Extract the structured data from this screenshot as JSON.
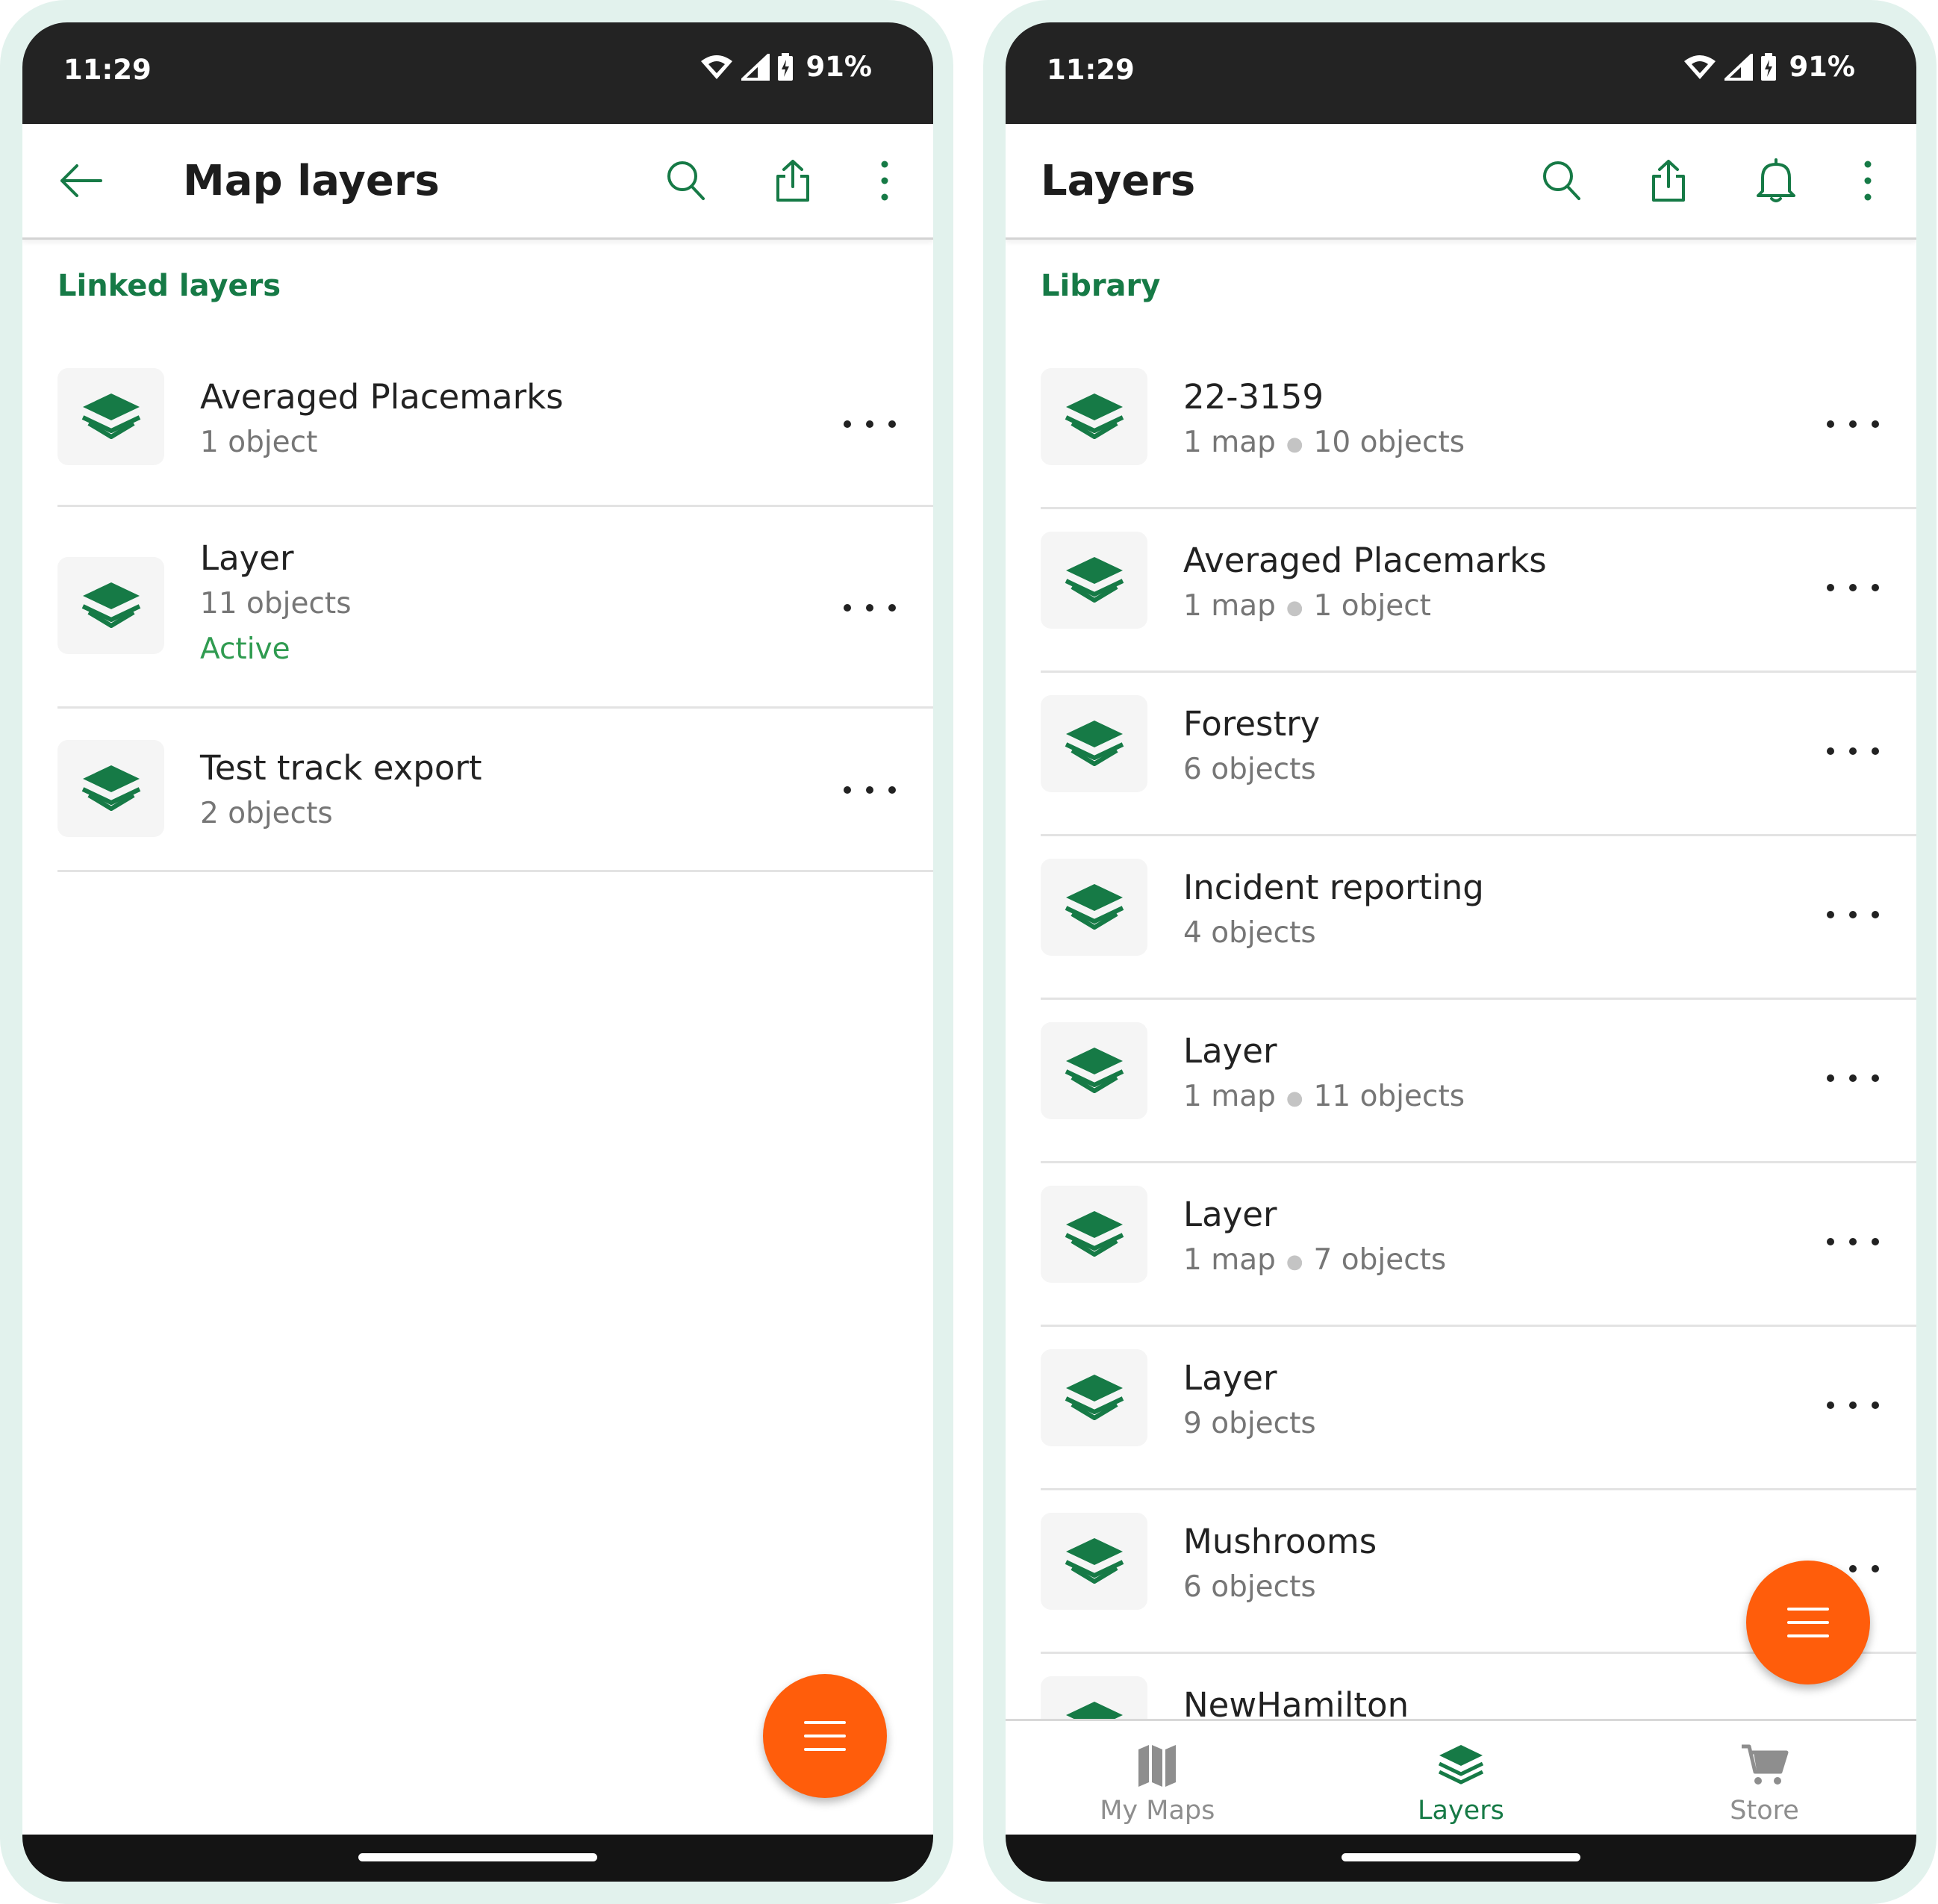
{
  "colors": {
    "accent": "#167a46",
    "fab": "#ff5d0b",
    "active": "#2f9b50",
    "statusbar": "#232323",
    "frame": "#e2f2ed"
  },
  "left": {
    "status": {
      "time": "11:29",
      "battery": "91%"
    },
    "appbar": {
      "title": "Map layers"
    },
    "section_header": "Linked layers",
    "items": [
      {
        "title": "Averaged Placemarks",
        "sub": "1 object"
      },
      {
        "title": "Layer",
        "sub": "11 objects",
        "status": "Active"
      },
      {
        "title": "Test track export",
        "sub": "2 objects"
      }
    ]
  },
  "right": {
    "status": {
      "time": "11:29",
      "battery": "91%"
    },
    "appbar": {
      "title": "Layers"
    },
    "section_header": "Library",
    "items": [
      {
        "title": "22-3159",
        "sub1": "1 map",
        "sub2": "10 objects"
      },
      {
        "title": "Averaged Placemarks",
        "sub1": "1 map",
        "sub2": "1 object"
      },
      {
        "title": "Forestry",
        "sub1": "6 objects"
      },
      {
        "title": "Incident reporting",
        "sub1": "4 objects"
      },
      {
        "title": "Layer",
        "sub1": "1 map",
        "sub2": "11 objects"
      },
      {
        "title": "Layer",
        "sub1": "1 map",
        "sub2": "7 objects"
      },
      {
        "title": "Layer",
        "sub1": "9 objects"
      },
      {
        "title": "Mushrooms",
        "sub1": "6 objects"
      },
      {
        "title": "NewHamilton"
      }
    ],
    "bottom_nav": [
      {
        "label": "My Maps",
        "icon": "map-icon"
      },
      {
        "label": "Layers",
        "icon": "layers-icon",
        "active": true
      },
      {
        "label": "Store",
        "icon": "cart-icon"
      }
    ]
  }
}
